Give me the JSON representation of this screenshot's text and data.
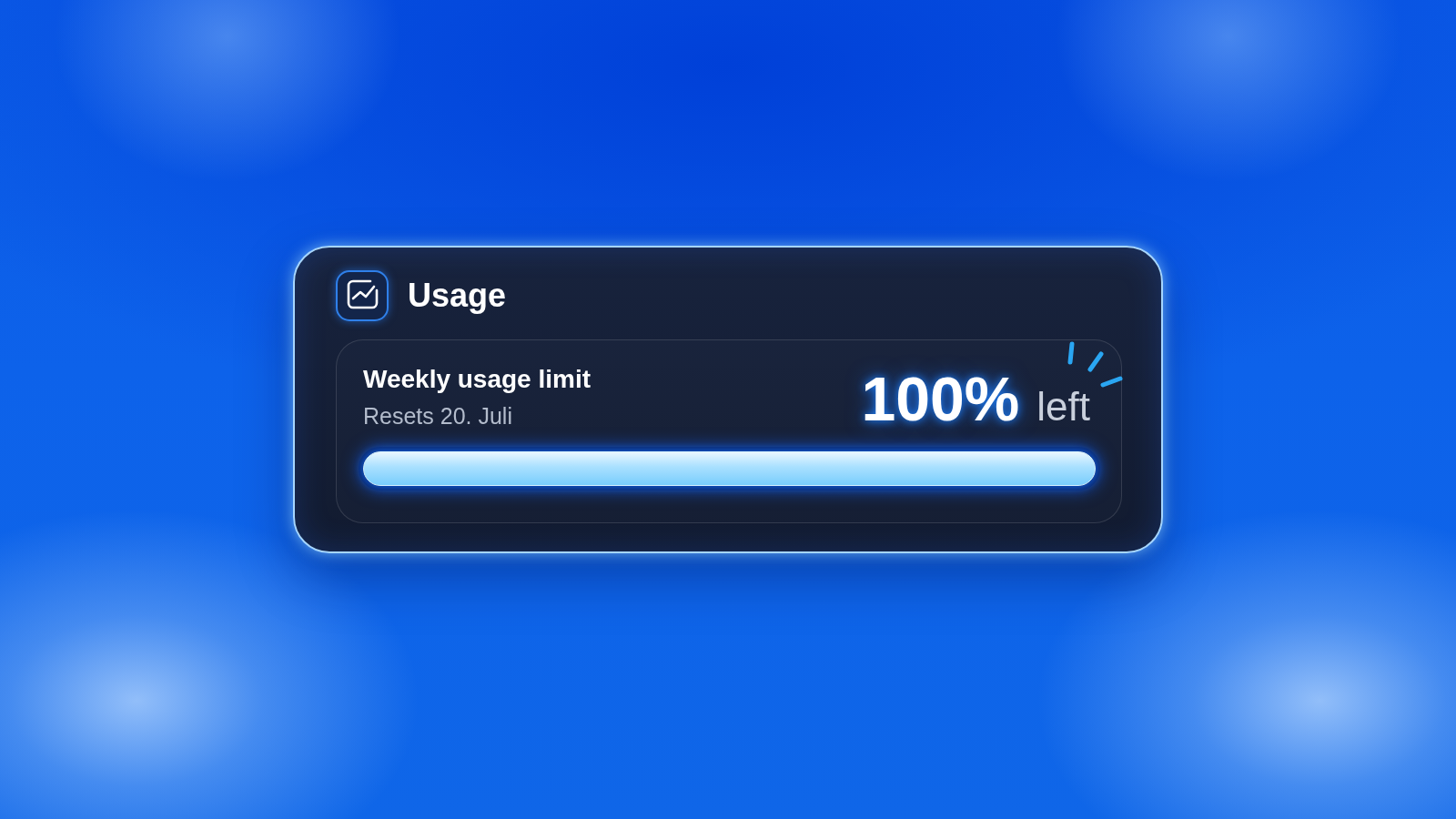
{
  "card": {
    "title": "Usage",
    "usage": {
      "label": "Weekly usage limit",
      "reset": "Resets 20. Juli",
      "percent": "100%",
      "suffix": "left",
      "level": 1
    }
  }
}
